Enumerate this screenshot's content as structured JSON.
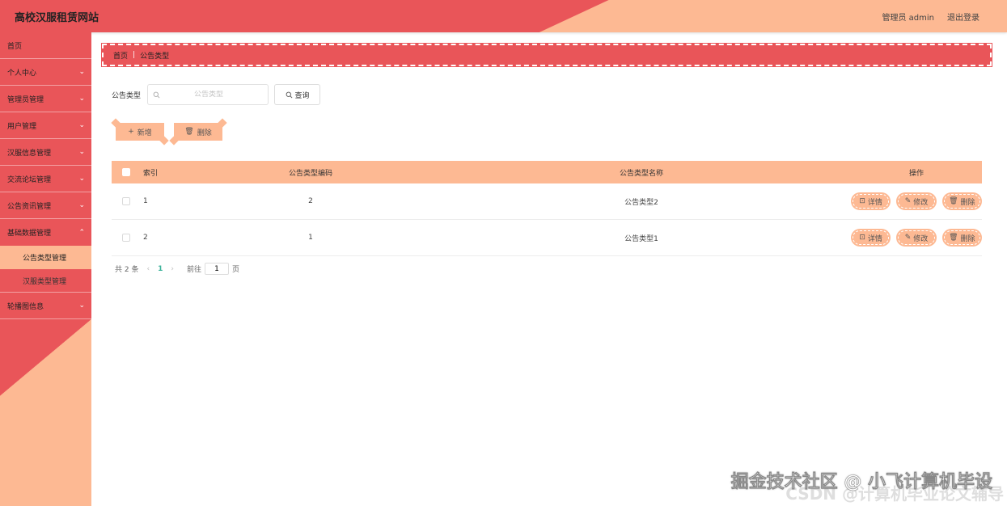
{
  "header": {
    "title": "高校汉服租赁网站",
    "user": "管理员 admin",
    "logout": "退出登录"
  },
  "sidebar": {
    "items": [
      {
        "label": "首页"
      },
      {
        "label": "个人中心"
      },
      {
        "label": "管理员管理"
      },
      {
        "label": "用户管理"
      },
      {
        "label": "汉服信息管理"
      },
      {
        "label": "交流论坛管理"
      },
      {
        "label": "公告资讯管理"
      },
      {
        "label": "基础数据管理"
      },
      {
        "label": "公告类型管理"
      },
      {
        "label": "汉服类型管理"
      },
      {
        "label": "轮播图信息"
      }
    ]
  },
  "breadcrumb": {
    "home": "首页",
    "sep": "|",
    "current": "公告类型"
  },
  "search": {
    "label": "公告类型",
    "placeholder": "公告类型",
    "button": "查询"
  },
  "actions": {
    "add": "新增",
    "delete": "删除"
  },
  "table": {
    "headers": {
      "index": "索引",
      "code": "公告类型编码",
      "name": "公告类型名称",
      "ops": "操作"
    },
    "rows": [
      {
        "index": "1",
        "code": "2",
        "name": "公告类型2"
      },
      {
        "index": "2",
        "code": "1",
        "name": "公告类型1"
      }
    ],
    "ops": {
      "detail": "详情",
      "edit": "修改",
      "delete": "删除"
    }
  },
  "pager": {
    "total": "共 2 条",
    "current": "1",
    "goto": "前往",
    "goto_value": "1",
    "page_unit": "页"
  },
  "watermark": {
    "line1": "掘金技术社区 @ 小飞计算机毕设",
    "line2": "CSDN @计算机毕业论文辅导"
  },
  "colors": {
    "primary": "#e95559",
    "secondary": "#fdb993",
    "accent": "#3cb39a"
  }
}
